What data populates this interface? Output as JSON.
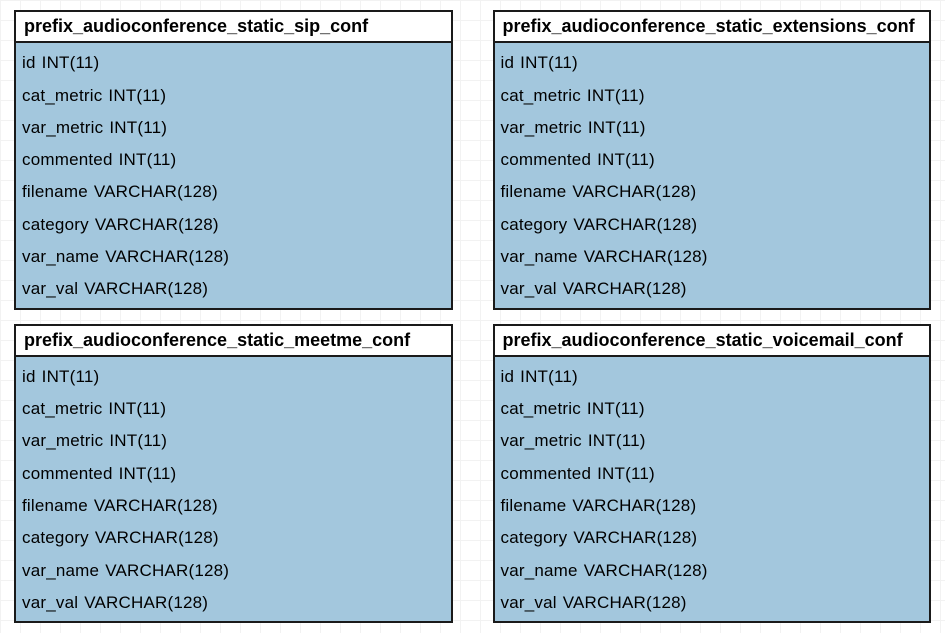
{
  "tables": [
    {
      "title": "prefix_audioconference_static_sip_conf",
      "columns": [
        {
          "name": "id",
          "type": "INT(11)"
        },
        {
          "name": "cat_metric",
          "type": "INT(11)"
        },
        {
          "name": "var_metric",
          "type": "INT(11)"
        },
        {
          "name": "commented",
          "type": "INT(11)"
        },
        {
          "name": "filename",
          "type": "VARCHAR(128)"
        },
        {
          "name": "category",
          "type": "VARCHAR(128)"
        },
        {
          "name": "var_name",
          "type": "VARCHAR(128)"
        },
        {
          "name": "var_val",
          "type": "VARCHAR(128)"
        }
      ]
    },
    {
      "title": "prefix_audioconference_static_extensions_conf",
      "columns": [
        {
          "name": "id",
          "type": "INT(11)"
        },
        {
          "name": "cat_metric",
          "type": "INT(11)"
        },
        {
          "name": "var_metric",
          "type": "INT(11)"
        },
        {
          "name": "commented",
          "type": "INT(11)"
        },
        {
          "name": "filename",
          "type": "VARCHAR(128)"
        },
        {
          "name": "category",
          "type": "VARCHAR(128)"
        },
        {
          "name": "var_name",
          "type": "VARCHAR(128)"
        },
        {
          "name": "var_val",
          "type": "VARCHAR(128)"
        }
      ]
    },
    {
      "title": "prefix_audioconference_static_meetme_conf",
      "columns": [
        {
          "name": "id",
          "type": "INT(11)"
        },
        {
          "name": "cat_metric",
          "type": "INT(11)"
        },
        {
          "name": "var_metric",
          "type": "INT(11)"
        },
        {
          "name": "commented",
          "type": "INT(11)"
        },
        {
          "name": "filename",
          "type": "VARCHAR(128)"
        },
        {
          "name": "category",
          "type": "VARCHAR(128)"
        },
        {
          "name": "var_name",
          "type": "VARCHAR(128)"
        },
        {
          "name": "var_val",
          "type": "VARCHAR(128)"
        }
      ]
    },
    {
      "title": "prefix_audioconference_static_voicemail_conf",
      "columns": [
        {
          "name": "id",
          "type": "INT(11)"
        },
        {
          "name": "cat_metric",
          "type": "INT(11)"
        },
        {
          "name": "var_metric",
          "type": "INT(11)"
        },
        {
          "name": "commented",
          "type": "INT(11)"
        },
        {
          "name": "filename",
          "type": "VARCHAR(128)"
        },
        {
          "name": "category",
          "type": "VARCHAR(128)"
        },
        {
          "name": "var_name",
          "type": "VARCHAR(128)"
        },
        {
          "name": "var_val",
          "type": "VARCHAR(128)"
        }
      ]
    }
  ]
}
